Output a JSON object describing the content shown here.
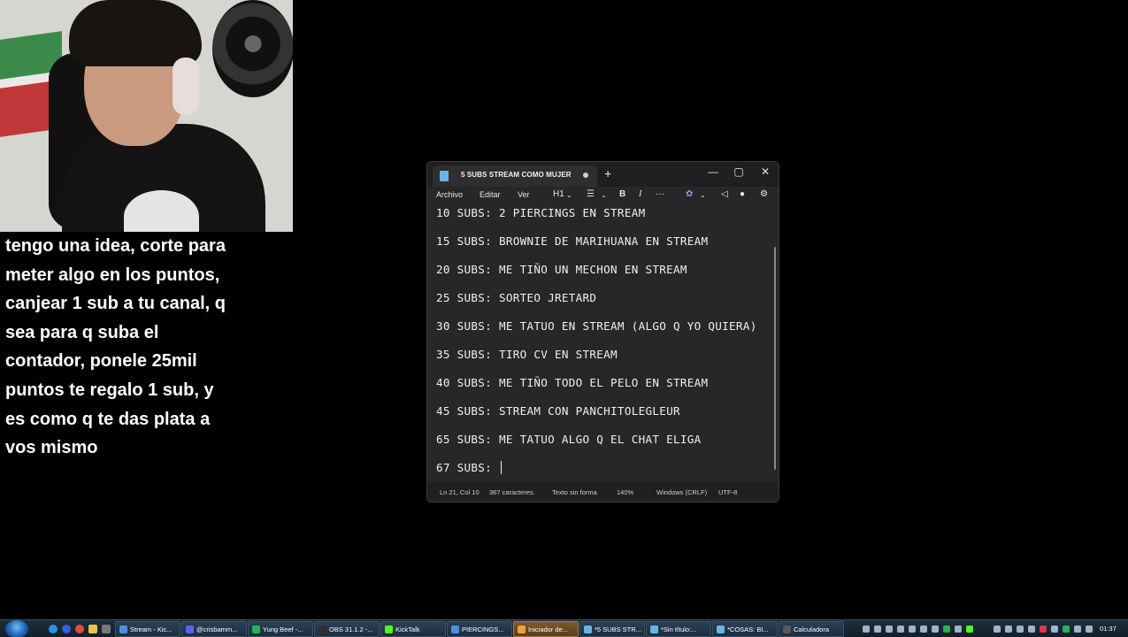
{
  "overlay": {
    "lines": [
      "tengo una idea, corte para",
      "meter algo en los puntos,",
      "canjear 1 sub a tu canal, q",
      "sea para q suba el",
      "contador, ponele 25mil",
      "puntos te regalo 1 sub, y",
      "es como q te das plata a",
      "vos mismo"
    ]
  },
  "notepad": {
    "tab_title": "5 SUBS STREAM COMO MUJER",
    "new_tab": "+",
    "window_controls": {
      "minimize": "—",
      "maximize": "▢",
      "close": "✕"
    },
    "menu": [
      "Archivo",
      "Editar",
      "Ver"
    ],
    "toolbar": {
      "heading": "H1",
      "bold": "B",
      "italic": "I",
      "more": "···"
    },
    "lines": [
      "10 SUBS: 2 PIERCINGS EN STREAM",
      "15 SUBS: BROWNIE DE MARIHUANA EN STREAM",
      "20 SUBS: ME TIÑO UN MECHON EN STREAM",
      "25 SUBS: SORTEO JRETARD",
      "30 SUBS: ME TATUO EN STREAM (ALGO Q YO QUIERA)",
      "35 SUBS: TIRO CV EN STREAM",
      "40 SUBS: ME TIÑO TODO EL PELO EN STREAM",
      "45 SUBS: STREAM CON PANCHITOLEGLEUR",
      "65 SUBS: ME TATUO ALGO Q EL CHAT ELIGA",
      "67 SUBS: "
    ],
    "status": {
      "position": "Ln 21, Col 10",
      "chars": "367 caracteres.",
      "format": "Texto sin forma",
      "zoom": "140%",
      "line_ending": "Windows (CRLF)",
      "encoding": "UTF-8"
    }
  },
  "taskbar": {
    "tasks": [
      {
        "label": "Stream - Kic...",
        "icon_color": "#4a90e2"
      },
      {
        "label": "@crisbamm...",
        "icon_color": "#5865f2"
      },
      {
        "label": "Yung Beef -...",
        "icon_color": "#1db954"
      },
      {
        "label": "OBS 31.1.2 -...",
        "icon_color": "#302e31"
      },
      {
        "label": "KickTalk",
        "icon_color": "#53fc18"
      },
      {
        "label": "PIERCINGS...",
        "icon_color": "#4a90e2"
      },
      {
        "label": "Iniciador de...",
        "icon_color": "#e8a33d",
        "active": true
      },
      {
        "label": "*5 SUBS STR...",
        "icon_color": "#67b7e6"
      },
      {
        "label": "*Sin título:...",
        "icon_color": "#67b7e6"
      },
      {
        "label": "*COSAS: BI...",
        "icon_color": "#67b7e6"
      },
      {
        "label": "Calculadora",
        "icon_color": "#5a5a5a"
      }
    ],
    "clock": "01:37"
  }
}
